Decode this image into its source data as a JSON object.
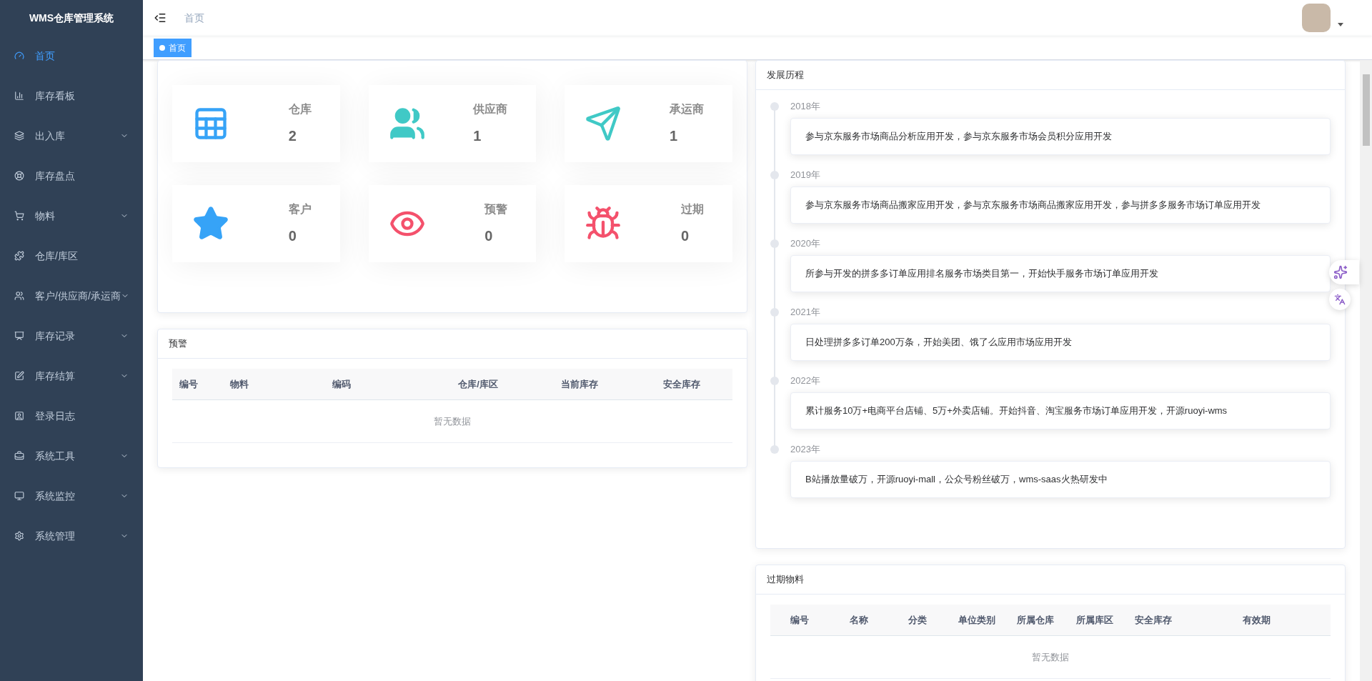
{
  "sidebar": {
    "title": "WMS仓库管理系统",
    "items": [
      {
        "label": "首页",
        "selected": true,
        "expandable": false
      },
      {
        "label": "库存看板",
        "selected": false,
        "expandable": false
      },
      {
        "label": "出入库",
        "selected": false,
        "expandable": true
      },
      {
        "label": "库存盘点",
        "selected": false,
        "expandable": false
      },
      {
        "label": "物料",
        "selected": false,
        "expandable": true
      },
      {
        "label": "仓库/库区",
        "selected": false,
        "expandable": false
      },
      {
        "label": "客户/供应商/承运商",
        "selected": false,
        "expandable": true
      },
      {
        "label": "库存记录",
        "selected": false,
        "expandable": true
      },
      {
        "label": "库存结算",
        "selected": false,
        "expandable": true
      },
      {
        "label": "登录日志",
        "selected": false,
        "expandable": false
      },
      {
        "label": "系统工具",
        "selected": false,
        "expandable": true
      },
      {
        "label": "系统监控",
        "selected": false,
        "expandable": true
      },
      {
        "label": "系统管理",
        "selected": false,
        "expandable": true
      }
    ]
  },
  "breadcrumb": [
    "首页"
  ],
  "tags": [
    {
      "label": "首页",
      "selected": true
    }
  ],
  "stats": [
    {
      "label": "仓库",
      "value": "2",
      "color": "#36a3f7"
    },
    {
      "label": "供应商",
      "value": "1",
      "color": "#40c9c6"
    },
    {
      "label": "承运商",
      "value": "1",
      "color": "#40c9c6"
    },
    {
      "label": "客户",
      "value": "0",
      "color": "#36a3f7"
    },
    {
      "label": "预警",
      "value": "0",
      "color": "#f4516c"
    },
    {
      "label": "过期",
      "value": "0",
      "color": "#f4516c"
    }
  ],
  "warning_panel": {
    "title": "预警",
    "columns": [
      "编号",
      "物料",
      "编码",
      "仓库/库区",
      "当前库存",
      "安全库存"
    ],
    "empty_text": "暂无数据"
  },
  "timeline_panel": {
    "title": "发展历程",
    "items": [
      {
        "year": "2018年",
        "text": "参与京东服务市场商品分析应用开发，参与京东服务市场会员积分应用开发"
      },
      {
        "year": "2019年",
        "text": "参与京东服务市场商品搬家应用开发，参与京东服务市场商品搬家应用开发，参与拼多多服务市场订单应用开发"
      },
      {
        "year": "2020年",
        "text": "所参与开发的拼多多订单应用排名服务市场类目第一，开始快手服务市场订单应用开发"
      },
      {
        "year": "2021年",
        "text": "日处理拼多多订单200万条，开始美团、饿了么应用市场应用开发"
      },
      {
        "year": "2022年",
        "text": "累计服务10万+电商平台店铺、5万+外卖店铺。开始抖音、淘宝服务市场订单应用开发，开源ruoyi-wms"
      },
      {
        "year": "2023年",
        "text": "B站播放量破万，开源ruoyi-mall，公众号粉丝破万，wms-saas火热研发中"
      }
    ]
  },
  "expired_panel": {
    "title": "过期物料",
    "columns": [
      "编号",
      "名称",
      "分类",
      "单位类别",
      "所属仓库",
      "所属库区",
      "安全库存",
      "有效期"
    ],
    "empty_text": "暂无数据"
  }
}
